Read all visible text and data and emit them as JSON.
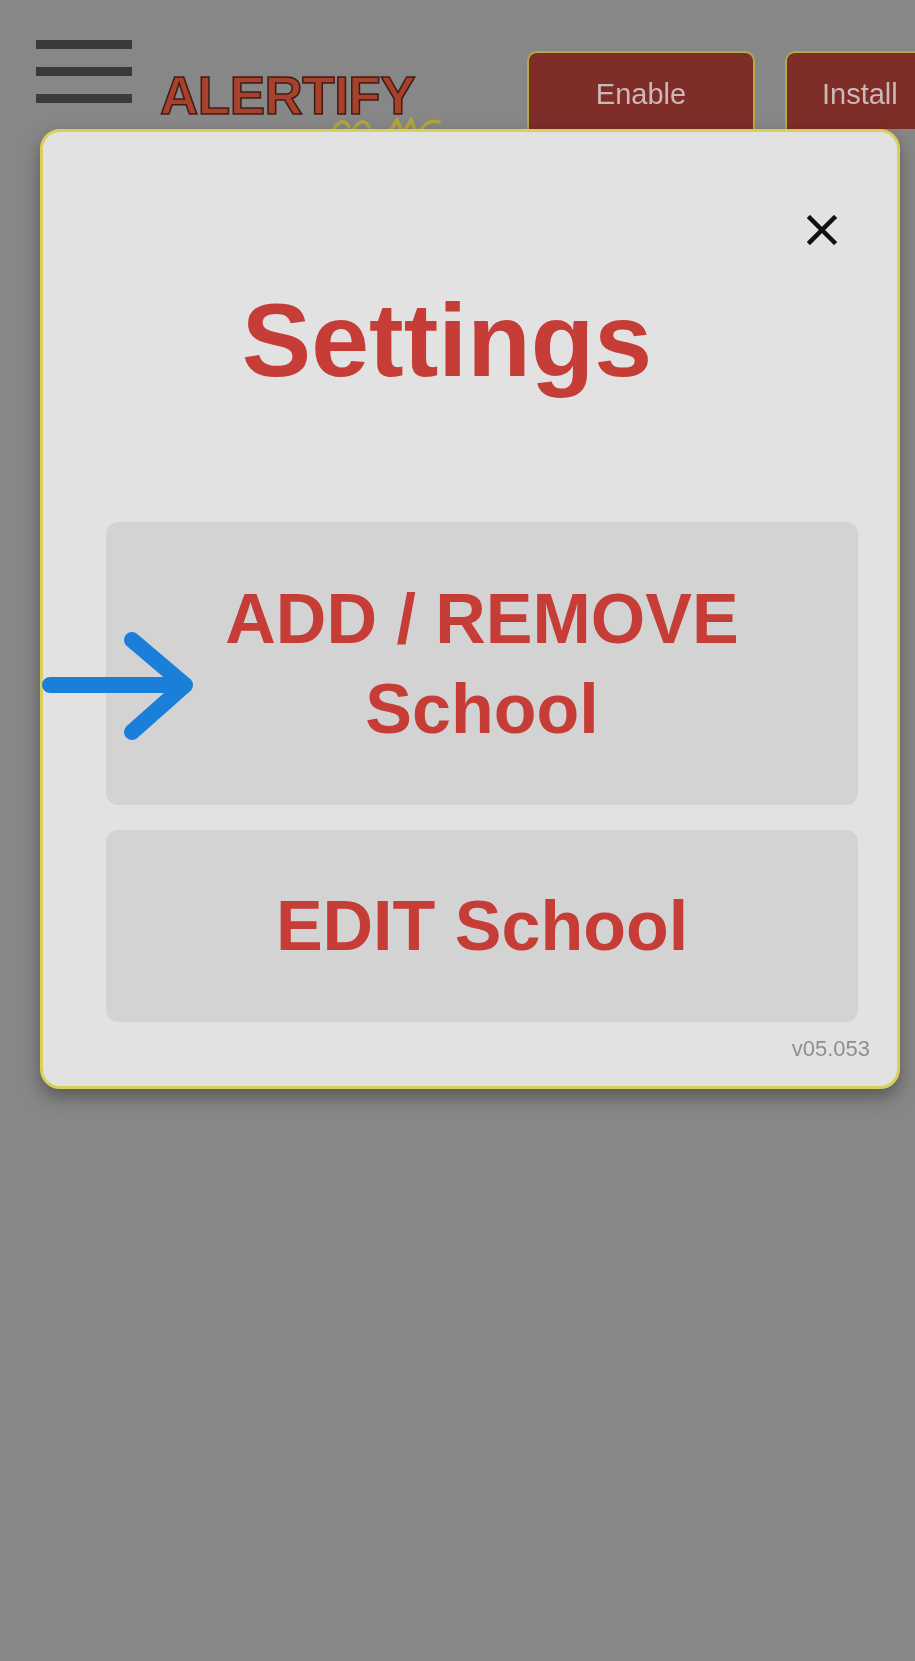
{
  "header": {
    "logo": "ALERTIFY",
    "buttons": [
      "Enable",
      "Install"
    ]
  },
  "dialog": {
    "title": "Settings",
    "options": [
      "ADD / REMOVE School",
      "EDIT School"
    ],
    "version": "v05.053"
  }
}
